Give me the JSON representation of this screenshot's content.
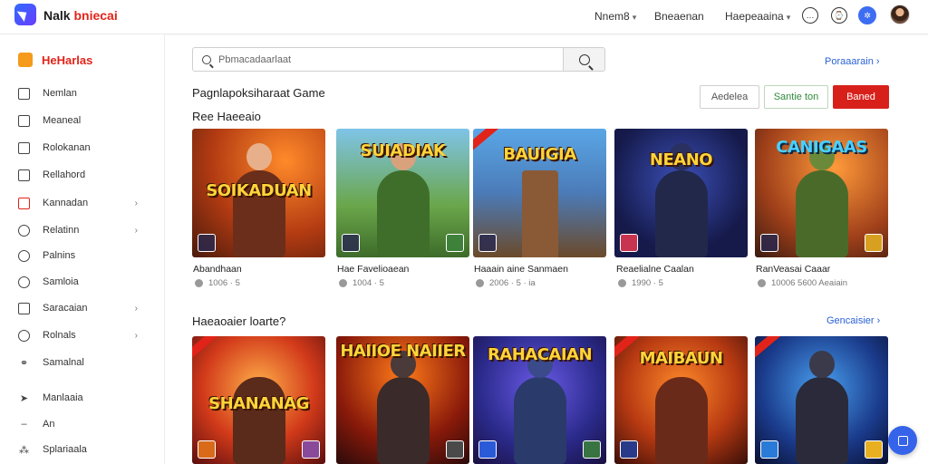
{
  "header": {
    "app_title_a": "Nalk",
    "app_title_b": "bniecai",
    "nav": [
      {
        "label": "Nnem8"
      },
      {
        "label": "Bneaenan"
      },
      {
        "label": "Haepeaaina"
      }
    ]
  },
  "sidebar": {
    "heading": "HeHarlas",
    "items": [
      {
        "label": "Nemlan"
      },
      {
        "label": "Meaneal"
      },
      {
        "label": "Rolokanan"
      },
      {
        "label": "Rellahord"
      },
      {
        "label": "Kannadan"
      },
      {
        "label": "Relatinn"
      },
      {
        "label": "Palnins"
      },
      {
        "label": "Samloia"
      },
      {
        "label": "Saracaian"
      },
      {
        "label": "Rolnals"
      },
      {
        "label": "Samalnal"
      },
      {
        "label": "Manlaaia"
      },
      {
        "label": "An"
      },
      {
        "label": "Splariaala"
      }
    ]
  },
  "search": {
    "placeholder": "Pbmacadaarlaat"
  },
  "top_link": "Poraaarain",
  "page_title": "Pagnlapoksiharaat Game",
  "buttons": {
    "outline": "Aedelea",
    "green": "Santie ton",
    "red": "Baned"
  },
  "section1": {
    "title": "Ree Haeeaio",
    "cards": [
      {
        "art": "SOIKADUAN",
        "name": "Abandhaan",
        "meta": "1006 · 5"
      },
      {
        "art": "SUIADIAK",
        "name": "Hae Favelioaean",
        "meta": "1004 · 5"
      },
      {
        "art": "BAUIGIA",
        "name": "Haaain aine Sanmaen",
        "meta": "2006 · 5 · ia"
      },
      {
        "art": "NEANO",
        "name": "Reaelialne Caalan",
        "meta": "1990 · 5"
      },
      {
        "art": "CANIGAAS",
        "name": "RanVeasai Caaar",
        "meta": "10006 5600 Aeaiain"
      }
    ]
  },
  "section2": {
    "title": "Haeaoaier loarte?",
    "link": "Gencaisier",
    "cards": [
      {
        "art": "SHANANAG"
      },
      {
        "art": "HAIIOE NAIIER"
      },
      {
        "art": "RAHACAIAN"
      },
      {
        "art": "MAIBAUN"
      },
      {
        "art": ""
      }
    ]
  },
  "colors": {
    "accent_red": "#e2231a",
    "accent_blue": "#2a62d6",
    "fab_blue": "#3563e9"
  }
}
